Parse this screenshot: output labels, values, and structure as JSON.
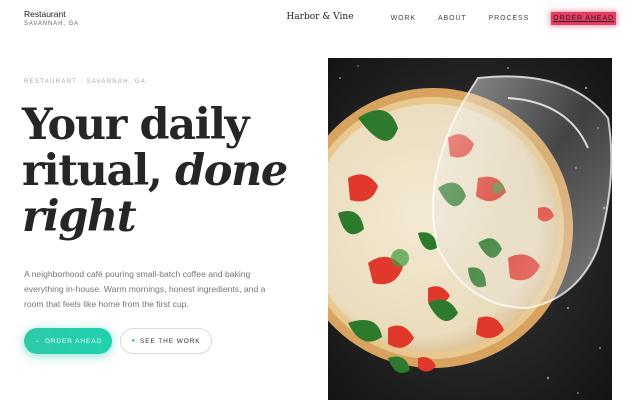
{
  "header": {
    "brand_name": "Restaurant",
    "brand_location": "SAVANNAH, GA",
    "site_title": "Harbor & Vine",
    "nav": [
      "WORK",
      "ABOUT",
      "PROCESS"
    ],
    "cta_label": "ORDER AHEAD"
  },
  "hero": {
    "eyebrow": "RESTAURANT · SAVANNAH, GA",
    "headline_line1": "Your daily",
    "headline_line2_plain": "ritual, ",
    "headline_line2_italic": "done",
    "headline_line3_italic": "right",
    "description": "A neighborhood café pouring small-batch coffee and baking everything in-house. Warm mornings, honest ingredients, and a room that feels like home from the first cup.",
    "primary_button": {
      "icon": "arrow-icon",
      "label": "ORDER AHEAD"
    },
    "secondary_button": {
      "icon": "dot-icon",
      "label": "SEE THE WORK"
    },
    "image_subject": "margherita-pizza-photo"
  },
  "colors": {
    "accent_teal": "#1fd2b0",
    "cta_highlight": "#e93b62",
    "text_dark": "#262626",
    "text_muted": "#767676"
  }
}
